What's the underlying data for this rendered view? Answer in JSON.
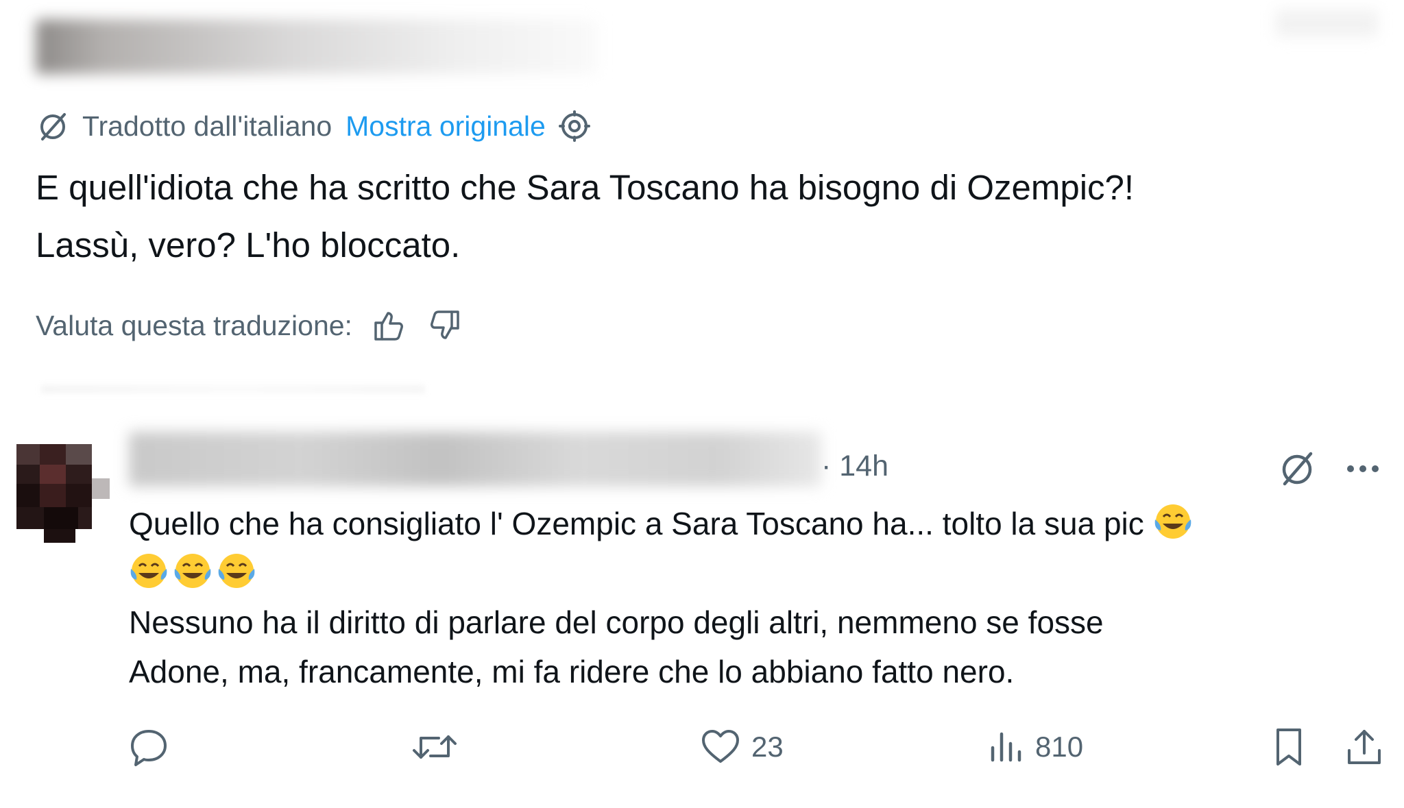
{
  "translation": {
    "label": "Tradotto dall'italiano",
    "show_original": "Mostra originale",
    "icons": [
      "translate-icon",
      "settings-icon"
    ]
  },
  "post": {
    "text": "E quell'idiota che ha scritto che Sara Toscano ha bisogno di Ozempic?!\nLassù, vero? L'ho bloccato."
  },
  "rate": {
    "label": "Valuta questa traduzione:",
    "icons": [
      "thumbs-up-icon",
      "thumbs-down-icon"
    ]
  },
  "reply": {
    "time": "· 14h",
    "line1": "Quello che ha consigliato l' Ozempic a Sara Toscano ha... tolto la sua pic",
    "line3": "Nessuno ha il diritto di parlare del corpo degli altri, nemmeno se fosse",
    "line4": "Adone, ma, francamente, mi fa ridere che lo abbiano fatto nero.",
    "emojis": [
      "face-with-tears-of-joy",
      "face-with-tears-of-joy",
      "face-with-tears-of-joy",
      "face-with-tears-of-joy"
    ],
    "actions": {
      "reply_icon": "reply-icon",
      "retweet_icon": "retweet-icon",
      "like_icon": "heart-icon",
      "likes": "23",
      "views_icon": "views-icon",
      "views": "810",
      "bookmark_icon": "bookmark-icon",
      "share_icon": "share-icon"
    }
  },
  "colors": {
    "text": "#0f1419",
    "muted": "#536471",
    "link": "#1d9bf0",
    "emoji_face": "#ffcc33",
    "emoji_tear": "#5aa9e6"
  }
}
